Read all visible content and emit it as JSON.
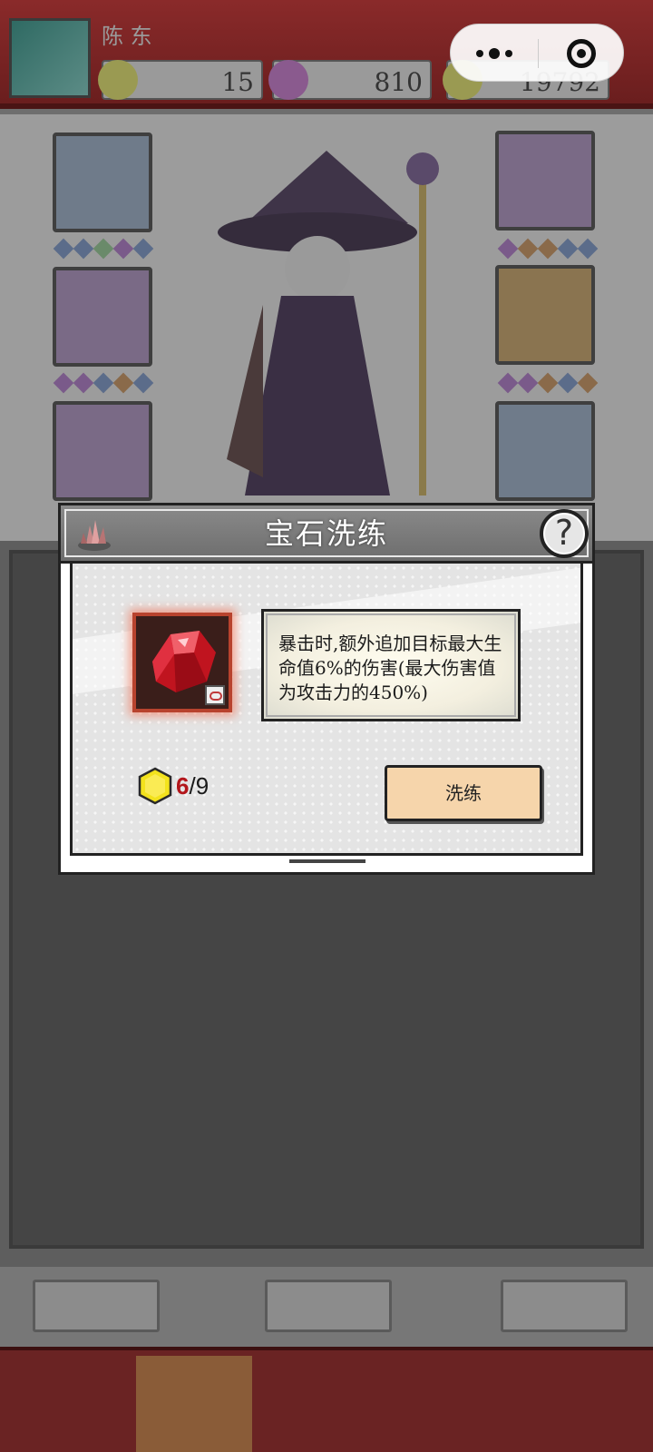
{
  "top_bar": {
    "player_name": "陈 东",
    "resources": [
      {
        "icon": "gold-hexagon-icon",
        "value": "15",
        "color": "#d8c41a"
      },
      {
        "icon": "purple-diamond-icon",
        "value": "810",
        "color": "#a64fb0"
      },
      {
        "icon": "gold-coin-icon",
        "value": "19792",
        "color": "#d8c41a"
      }
    ]
  },
  "mini_program_capsule": {
    "more_icon": "more-dots-icon",
    "close_icon": "target-circle-icon"
  },
  "equipment": {
    "left_slots": [
      "helmet-icon",
      "armor-icon",
      "boots-icon"
    ],
    "right_slots": [
      "gloves-icon",
      "ring-icon",
      "necklace-icon"
    ]
  },
  "bottom_buttons": [
    "",
    "",
    ""
  ],
  "nav_tabs": [
    "",
    "",
    "",
    "",
    ""
  ],
  "modal": {
    "title": "宝石洗练",
    "title_icon": "crystal-cluster-icon",
    "help_label": "?",
    "gem_icon": "red-ruby-gem-icon",
    "description": "暴击时,额外追加目标最大生命值6%的伤害(最大伤害值为攻击力的450%)",
    "cost": {
      "icon": "gold-hexagon-icon",
      "current": "6",
      "separator": "/",
      "required": "9"
    },
    "refine_button_label": "洗练"
  },
  "colors": {
    "accent_red": "#b3161b",
    "button_fill": "#f6d5ab",
    "header_gray": "#7a7a7a"
  }
}
